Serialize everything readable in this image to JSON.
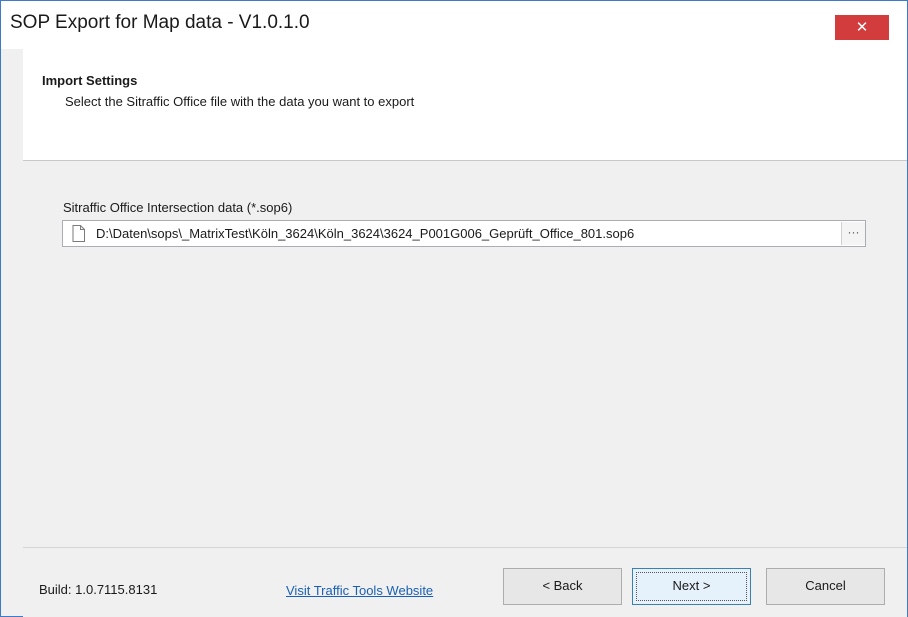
{
  "window": {
    "title": "SOP Export for Map data - V1.0.1.0",
    "close_label": "✕"
  },
  "header": {
    "title": "Import Settings",
    "subtitle": "Select the Sitraffic Office file with the data you want to export"
  },
  "form": {
    "field_label": "Sitraffic Office Intersection data (*.sop6)",
    "file_path": "D:\\Daten\\sops\\_MatrixTest\\Köln_3624\\Köln_3624\\3624_P001G006_Geprüft_Office_801.sop6",
    "browse_label": "···"
  },
  "footer": {
    "build": "Build: 1.0.7115.8131",
    "website_link": "Visit Traffic Tools Website",
    "back_label": "< Back",
    "next_label": "Next >",
    "cancel_label": "Cancel"
  },
  "colors": {
    "close_button": "#d23c3c",
    "link": "#1a5fb4",
    "window_border": "#3d7ac9"
  },
  "icons": {
    "file": "file-icon",
    "close": "close-icon",
    "browse": "ellipsis-icon"
  }
}
